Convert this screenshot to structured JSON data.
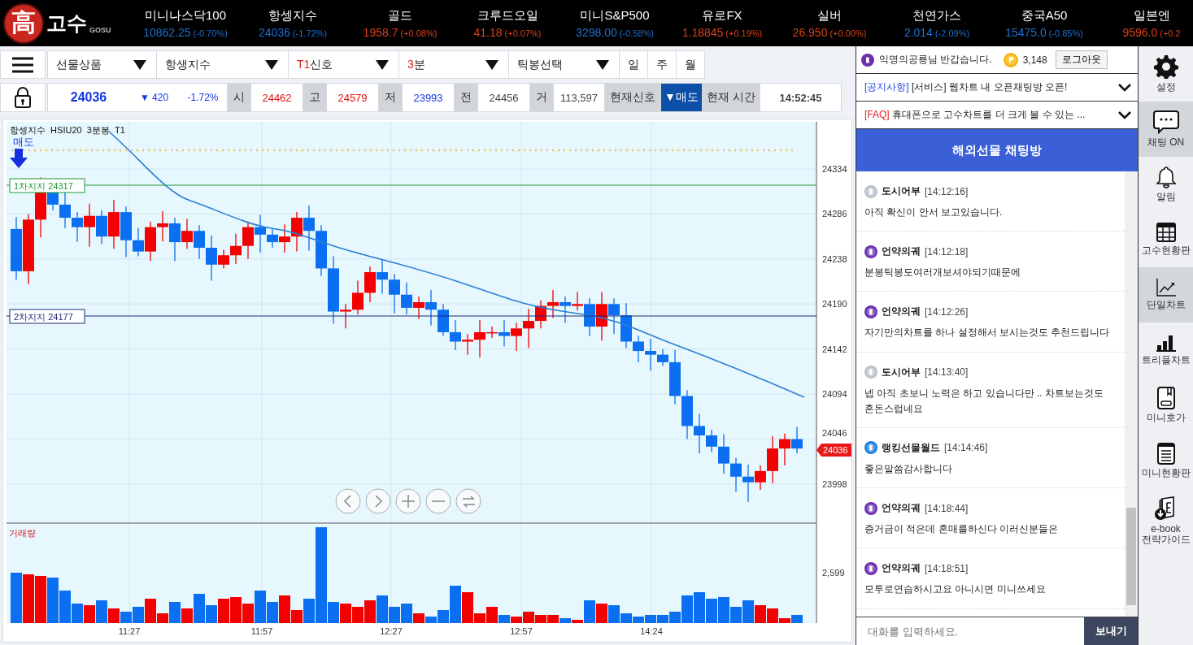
{
  "logo": {
    "mark": "高",
    "name": "고수",
    "subtitle": "GOSU"
  },
  "tickers": [
    {
      "name": "미니나스닥100",
      "value": "10862.25",
      "change": "(-0.70%)",
      "color": "#1f6fd0"
    },
    {
      "name": "항셍지수",
      "value": "24036",
      "change": "(-1.72%)",
      "color": "#1f6fd0"
    },
    {
      "name": "골드",
      "value": "1958.7",
      "change": "(+0.08%)",
      "color": "#d8401a"
    },
    {
      "name": "크루드오일",
      "value": "41.18",
      "change": "(+0.07%)",
      "color": "#d8401a"
    },
    {
      "name": "미니S&P500",
      "value": "3298.00",
      "change": "(-0.58%)",
      "color": "#1f6fd0"
    },
    {
      "name": "유로FX",
      "value": "1.18845",
      "change": "(+0.19%)",
      "color": "#d8401a"
    },
    {
      "name": "실버",
      "value": "26.950",
      "change": "(+0.00%)",
      "color": "#d8401a"
    },
    {
      "name": "천연가스",
      "value": "2.014",
      "change": "(-2.09%)",
      "color": "#1f6fd0"
    },
    {
      "name": "중국A50",
      "value": "15475.0",
      "change": "(-0.85%)",
      "color": "#1f6fd0"
    },
    {
      "name": "일본엔",
      "value": "9596.0",
      "change": "(+0.2",
      "color": "#d8401a"
    }
  ],
  "toolbar": {
    "dropdowns": [
      {
        "label": "선물상품"
      },
      {
        "label": "항생지수"
      },
      {
        "accent": "T1",
        "label": "신호"
      },
      {
        "accent": "3",
        "label": "분"
      },
      {
        "label": "틱봉선택"
      }
    ],
    "periods": [
      {
        "label": "일"
      },
      {
        "label": "주"
      },
      {
        "label": "월"
      }
    ]
  },
  "quote": {
    "price": "24036",
    "change": "▼ 420",
    "rate": "-1.72%",
    "fields": [
      {
        "label": "시",
        "value": "24462",
        "color": "#e01010"
      },
      {
        "label": "고",
        "value": "24579",
        "color": "#e01010"
      },
      {
        "label": "저",
        "value": "23993",
        "color": "#1538e0"
      },
      {
        "label": "전",
        "value": "24456",
        "color": "#444444"
      },
      {
        "label": "거",
        "value": "113,597",
        "color": "#444444"
      }
    ],
    "signal_label": "현재신호",
    "signal": "▼매도",
    "time_label": "현재 시간",
    "time": "14:52:45"
  },
  "chart": {
    "title": "항셍지수  HSIU20  3분봉  T1",
    "signal": "매도",
    "supports": [
      {
        "label": "1차지지 24317",
        "kind": "primary"
      },
      {
        "label": "2차지지 24177",
        "kind": "secondary"
      }
    ],
    "y_ticks": [
      "24334",
      "24286",
      "24238",
      "24190",
      "24142",
      "24094",
      "24046",
      "23998"
    ],
    "last_price": "24036",
    "volume_label": "거래량",
    "volume_tick": "2,599",
    "x_ticks": [
      "11:27",
      "11:57",
      "12:27",
      "12:57",
      "14:24"
    ]
  },
  "chat": {
    "greeting": "익명의공룡님 반갑습니다.",
    "points": "3,148",
    "logout": "로그아웃",
    "notices": [
      {
        "tag": "[공지사항]",
        "kind": "notice",
        "text": "[서비스] 웹차트 내 오픈채팅방 오픈!"
      },
      {
        "tag": "[FAQ]",
        "kind": "faq",
        "text": "휴대폰으로 고수차트를 더 크게 볼 수 있는 ..."
      }
    ],
    "title": "해외선물 채팅방",
    "messages": [
      {
        "color": "#b8c2cc",
        "user": "도시어부",
        "time": "[14:12:16]",
        "text": "아직 확신이 안서 보고있습니다."
      },
      {
        "color": "#6b2fae",
        "user": "언약의궤",
        "time": "[14:12:18]",
        "text": "분봉틱봉도여러개보셔야되기때문에"
      },
      {
        "color": "#6b2fae",
        "user": "언약의궤",
        "time": "[14:12:26]",
        "text": "자기만의차트를 하나 설정해서 보시는것도 추천드립니다"
      },
      {
        "color": "#b8c2cc",
        "user": "도시어부",
        "time": "[14:13:40]",
        "text": "넵 아직 초보니 노력은 하고 있습니다만 .. 차트보는것도 혼돈스럽네요"
      },
      {
        "color": "#1a7fe0",
        "user": "랭킹선물월드",
        "time": "[14:14:46]",
        "text": "좋은말씀감사합니다"
      },
      {
        "color": "#6b2fae",
        "user": "언약의궤",
        "time": "[14:18:44]",
        "text": "증거금이 적은데 혼매를하신다 이러신분들은"
      },
      {
        "color": "#6b2fae",
        "user": "언약의궤",
        "time": "[14:18:51]",
        "text": "모투로연습하시고요 아니시면 미니쓰세요"
      }
    ],
    "placeholder": "대화를 입력하세요.",
    "send": "보내기"
  },
  "sidebar": [
    {
      "label": "설정",
      "kind": "gear",
      "selected": false
    },
    {
      "label": "채팅 ON",
      "kind": "chat",
      "selected": true
    },
    {
      "label": "알림",
      "kind": "bell",
      "selected": false
    },
    {
      "label": "고수현황판",
      "kind": "grid",
      "selected": false
    },
    {
      "label": "단일차트",
      "kind": "line",
      "selected": true
    },
    {
      "label": "트리플차트",
      "kind": "bars",
      "selected": false
    },
    {
      "label": "미니호가",
      "kind": "device",
      "selected": false
    },
    {
      "label": "미니현황판",
      "kind": "notepad",
      "selected": false
    },
    {
      "label": "e-book\n전략가이드",
      "kind": "book",
      "selected": false
    }
  ]
}
